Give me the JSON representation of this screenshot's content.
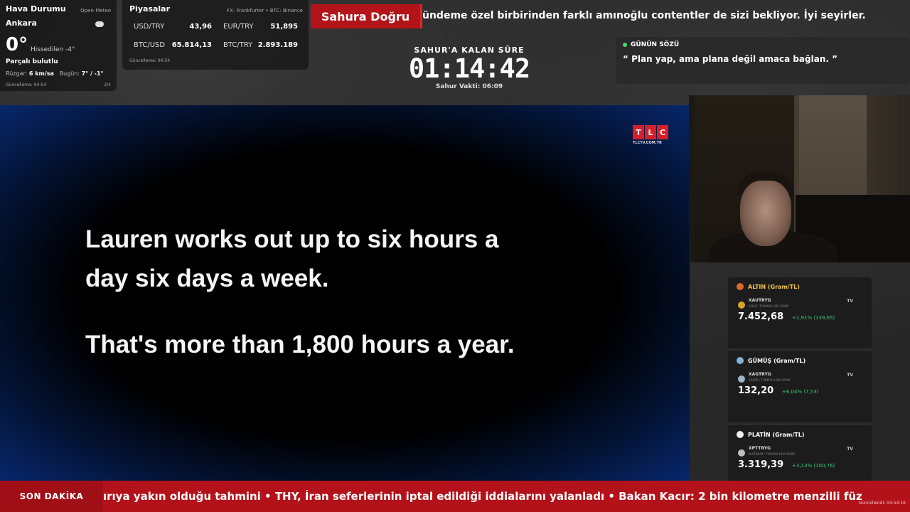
{
  "weather": {
    "title": "Hava Durumu",
    "source": "Open-Meteo",
    "city": "Ankara",
    "temp": "0°",
    "feels": "Hissedilen -4°",
    "desc": "Parçalı bulutlu",
    "wind_label": "Rüzgar:",
    "wind_value": "6 km/sa",
    "today_label": "Bugün:",
    "today_value": "7° / -1°",
    "updated": "Güncelleme: 04:54",
    "page": "2/4"
  },
  "markets": {
    "title": "Piyasalar",
    "source": "FX: Frankfurter • BTC: Binance",
    "rows": [
      {
        "label": "USD/TRY",
        "value": "43,96"
      },
      {
        "label": "EUR/TRY",
        "value": "51,895"
      },
      {
        "label": "BTC/USD",
        "value": "65.814,13"
      },
      {
        "label": "BTC/TRY",
        "value": "2.893.189"
      }
    ],
    "updated": "Güncelleme: 04:54"
  },
  "top_banner": {
    "tag": "Sahura Doğru",
    "text": "ündeme özel birbirinden farklı amınoğlu contentler de sizi bekliyor. İyi seyirler."
  },
  "countdown": {
    "label": "SAHUR'A KALAN SÜRE",
    "time": "01:14:42",
    "sub": "Sahur Vakti: 06:09"
  },
  "quote": {
    "heading": "GÜNÜN SÖZÜ",
    "text": "“ Plan yap, ama plana değil amaca bağlan. ”"
  },
  "video": {
    "channel_letters": [
      "T",
      "L",
      "C"
    ],
    "channel_url": "TLCTV.COM.TR",
    "subtitle_lines": [
      "Lauren works out up to six hours a",
      "day six days a week.",
      "That's more than 1,800 hours a year."
    ]
  },
  "metals": [
    {
      "heading": "ALTIN (Gram/TL)",
      "symbol": "XAUTRYG",
      "name": "GOLD / TURKISH LIRA GRAM",
      "price": "7.452,68",
      "change": "+1,91% (139,65)",
      "color": "#d4a52a"
    },
    {
      "heading": "GÜMÜŞ (Gram/TL)",
      "symbol": "XAGTRYG",
      "name": "SILVER / TURKISH LIRA GRAM",
      "price": "132,20",
      "change": "+6,04% (7,53)",
      "color": "#9fb4c8"
    },
    {
      "heading": "PLATİN (Gram/TL)",
      "symbol": "XPTTRYG",
      "name": "PLATINUM / TURKISH LIRA GRAM",
      "price": "3.319,39",
      "change": "+3,13% (100,76)",
      "color": "#e8e8e8"
    }
  ],
  "metal_tv": "TV",
  "ticker": {
    "tag": "SON DAKİKA",
    "text": "ırıya yakın olduğu tahmini   •   THY, İran seferlerinin iptal edildiği iddialarını yalanladı   •   Bakan Kacır: 2 bin kilometre menzilli füz",
    "updated": "Güncellendi: 04:54:16"
  }
}
